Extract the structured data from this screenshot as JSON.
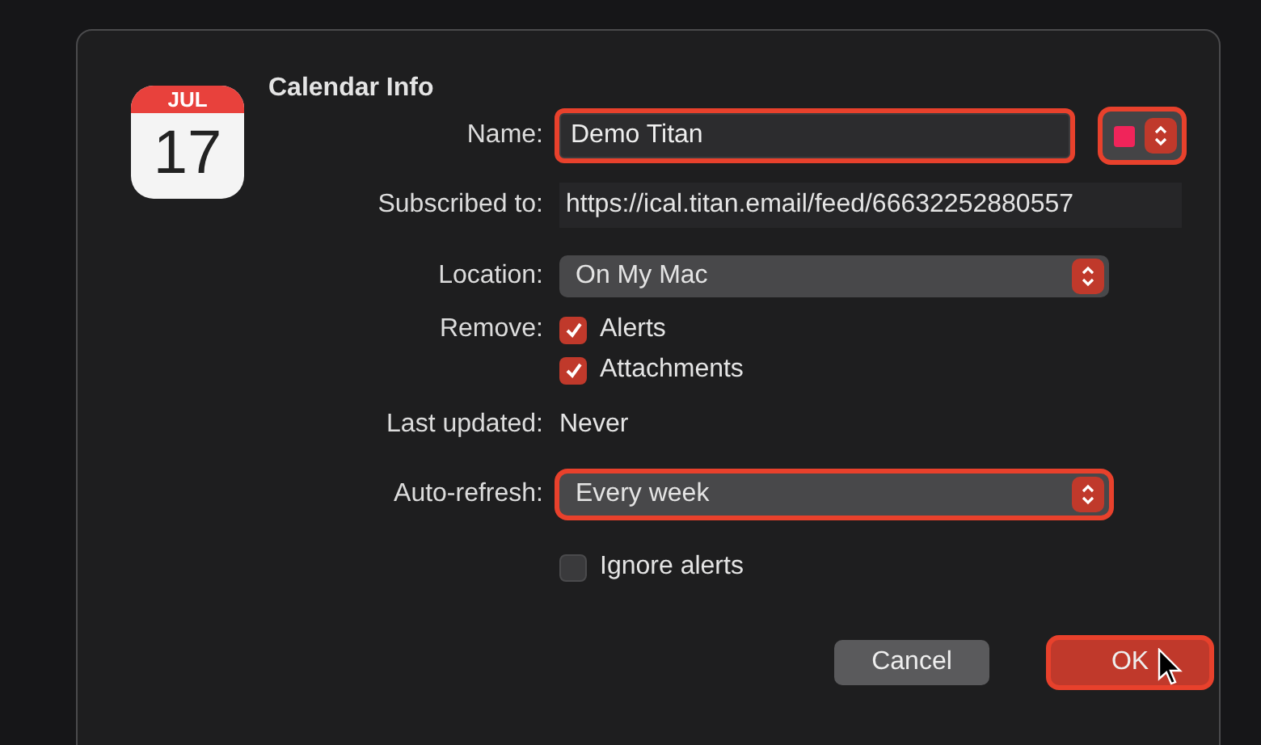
{
  "icon": {
    "month": "JUL",
    "day": "17"
  },
  "title": "Calendar Info",
  "name": {
    "label": "Name:",
    "value": "Demo Titan",
    "highlighted": true,
    "color": "#f0245a",
    "color_highlighted": true
  },
  "subscribed": {
    "label": "Subscribed to:",
    "value": "https://ical.titan.email/feed/66632252880557"
  },
  "location": {
    "label": "Location:",
    "value": "On My Mac",
    "highlighted": false
  },
  "remove": {
    "label": "Remove:",
    "options": [
      {
        "label": "Alerts",
        "checked": true
      },
      {
        "label": "Attachments",
        "checked": true
      }
    ]
  },
  "last_updated": {
    "label": "Last updated:",
    "value": "Never"
  },
  "auto_refresh": {
    "label": "Auto-refresh:",
    "value": "Every week",
    "highlighted": true
  },
  "ignore_alerts": {
    "label": "Ignore alerts",
    "checked": false
  },
  "buttons": [
    {
      "label": "Cancel",
      "kind": "secondary",
      "highlighted": false
    },
    {
      "label": "OK",
      "kind": "primary",
      "highlighted": true
    }
  ]
}
